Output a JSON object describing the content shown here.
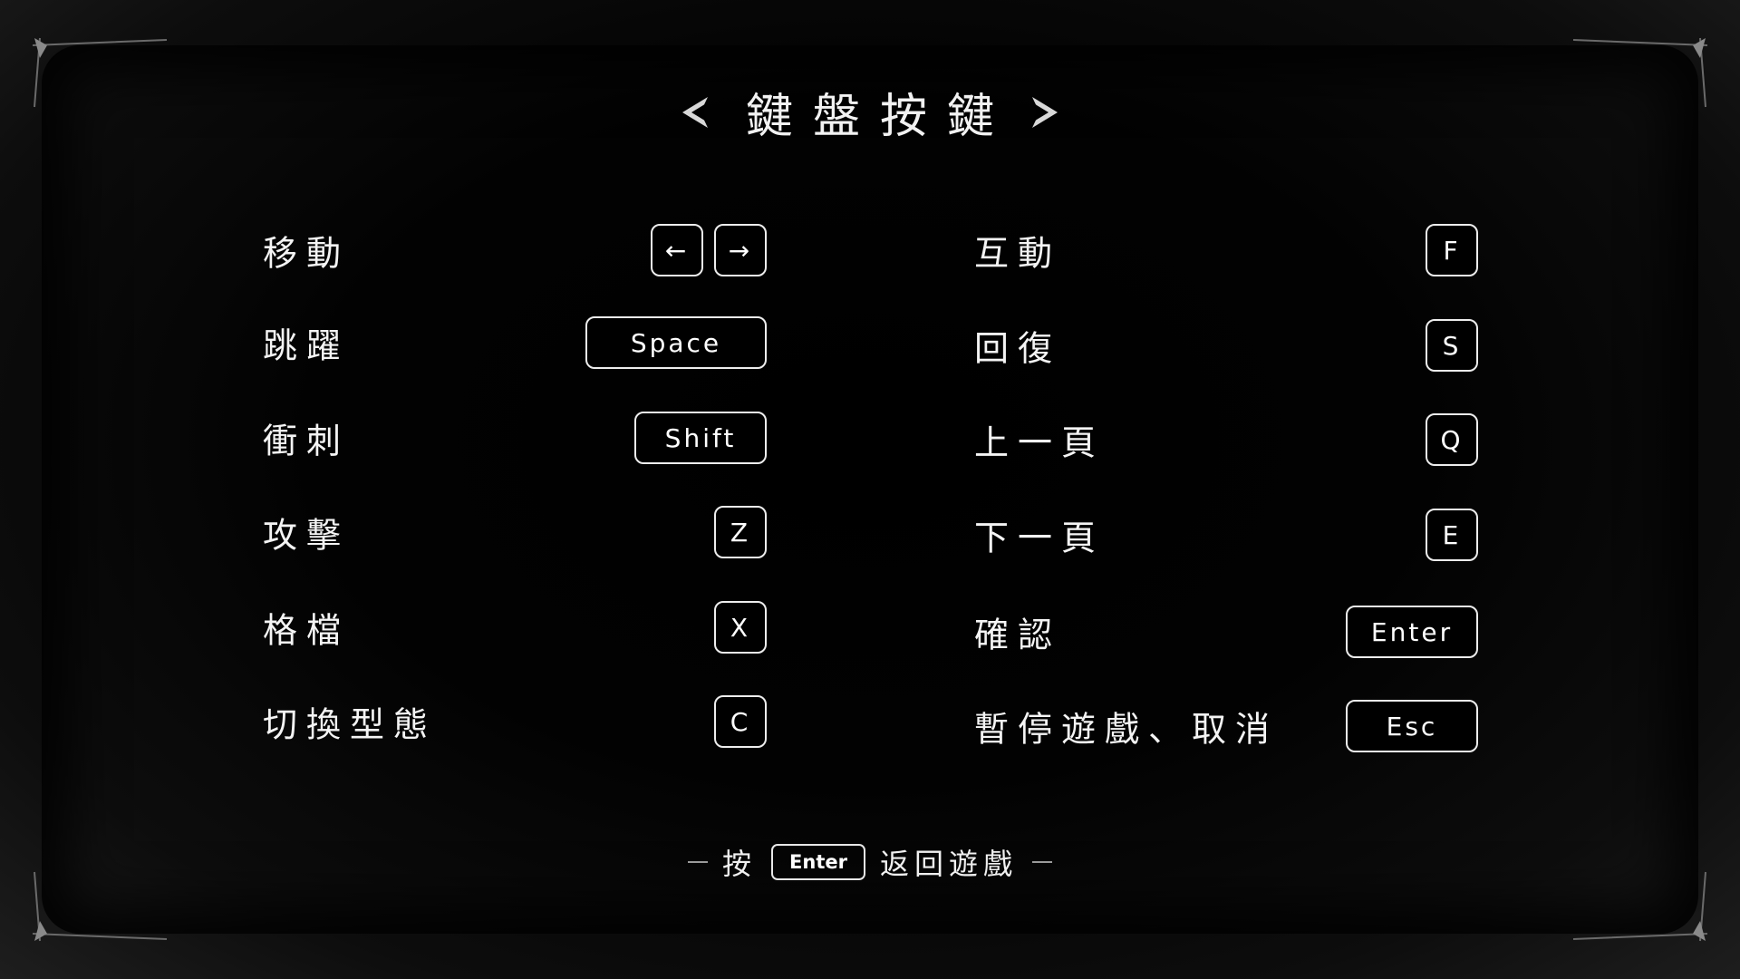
{
  "title": "鍵盤按鍵",
  "left_column": [
    {
      "action": "移動",
      "keys": [
        "←",
        "→"
      ]
    },
    {
      "action": "跳躍",
      "keys": [
        "Space"
      ]
    },
    {
      "action": "衝刺",
      "keys": [
        "Shift"
      ]
    },
    {
      "action": "攻擊",
      "keys": [
        "Z"
      ]
    },
    {
      "action": "格檔",
      "keys": [
        "X"
      ]
    },
    {
      "action": "切換型態",
      "keys": [
        "C"
      ]
    }
  ],
  "right_column": [
    {
      "action": "互動",
      "keys": [
        "F"
      ]
    },
    {
      "action": "回復",
      "keys": [
        "S"
      ]
    },
    {
      "action": "上一頁",
      "keys": [
        "Q"
      ]
    },
    {
      "action": "下一頁",
      "keys": [
        "E"
      ]
    },
    {
      "action": "確認",
      "keys": [
        "Enter"
      ]
    },
    {
      "action": "暫停遊戲、取消",
      "keys": [
        "Esc"
      ]
    }
  ],
  "footer": {
    "prefix": "按",
    "key": "Enter",
    "suffix": "返回遊戲"
  },
  "colors": {
    "background": "#000000",
    "text": "#f4f4f4",
    "key_border": "#ededed"
  }
}
